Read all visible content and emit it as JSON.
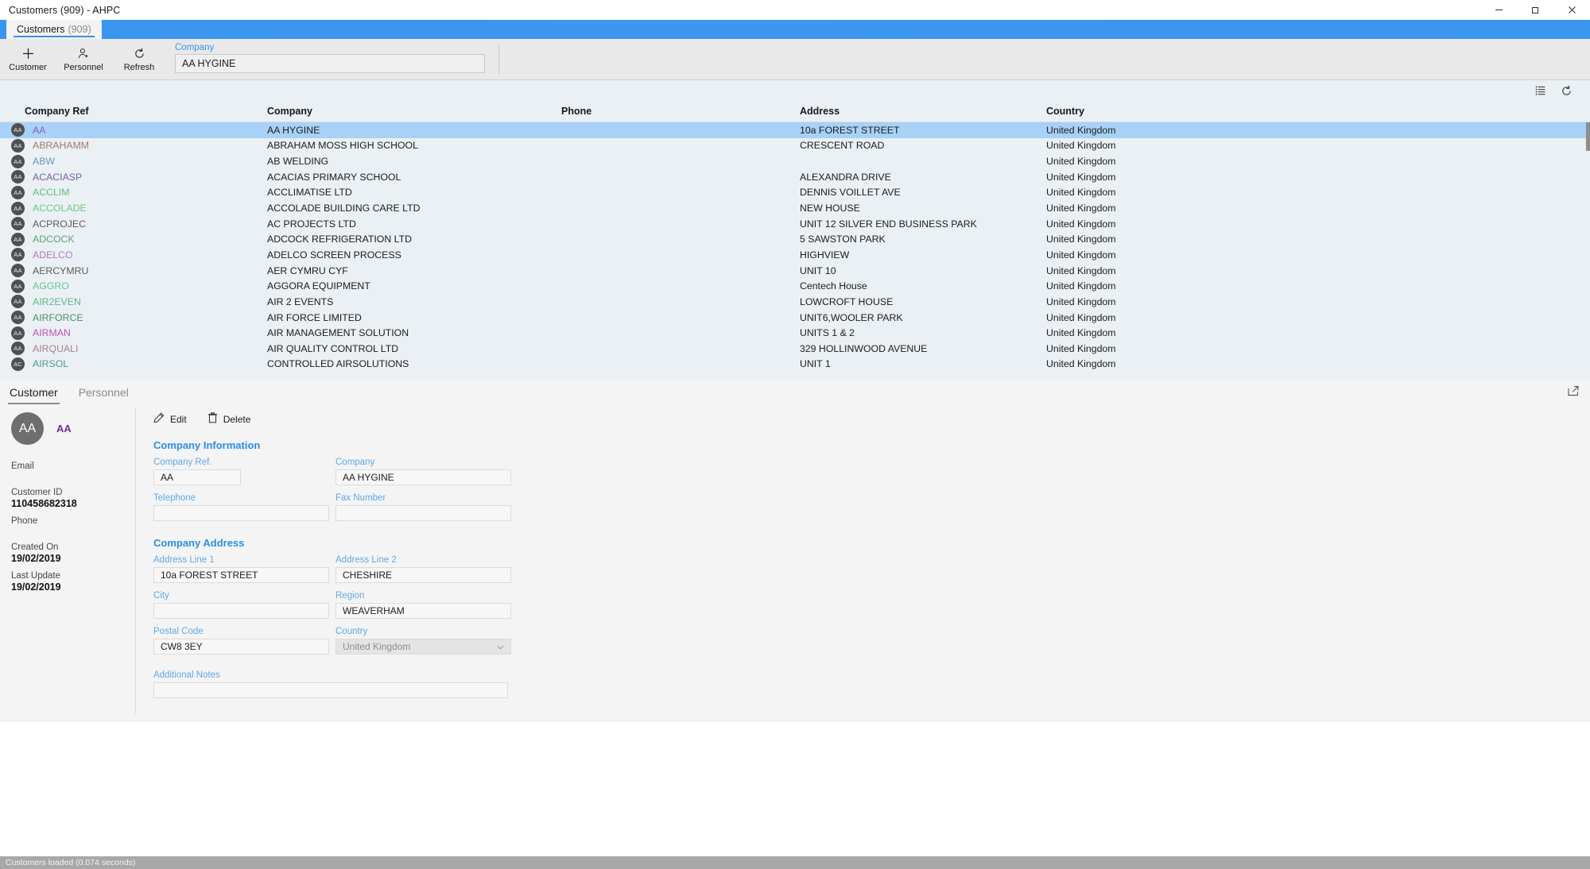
{
  "window": {
    "title": "Customers  (909) - AHPC",
    "minimize_label": "─",
    "maximize_label": "❐",
    "close_label": "✕"
  },
  "tabstrip": {
    "tab_label": "Customers",
    "tab_count": "(909)"
  },
  "toolbar": {
    "customer_label": "Customer",
    "personnel_label": "Personnel",
    "refresh_label": "Refresh",
    "search_label": "Company",
    "search_value": "AA HYGINE",
    "search_placeholder": "Company"
  },
  "grid": {
    "columns": [
      "Company Ref",
      "Company",
      "Phone",
      "Address",
      "Country"
    ],
    "rows": [
      {
        "initials": "AA",
        "ref": "AA",
        "ref_color": "#8a5fc4",
        "company": "AA HYGINE",
        "phone": "",
        "address": "10a FOREST STREET",
        "country": "United Kingdom",
        "selected": true
      },
      {
        "initials": "AA",
        "ref": "ABRAHAMM",
        "ref_color": "#a07b72",
        "company": "ABRAHAM MOSS HIGH SCHOOL",
        "phone": "",
        "address": "CRESCENT ROAD",
        "country": "United Kingdom",
        "selected": false
      },
      {
        "initials": "AA",
        "ref": "ABW",
        "ref_color": "#6c94bd",
        "company": "AB WELDING",
        "phone": "",
        "address": "",
        "country": "United Kingdom",
        "selected": false
      },
      {
        "initials": "AA",
        "ref": "ACACIASP",
        "ref_color": "#7464a8",
        "company": "ACACIAS PRIMARY SCHOOL",
        "phone": "",
        "address": "ALEXANDRA DRIVE",
        "country": "United Kingdom",
        "selected": false
      },
      {
        "initials": "AA",
        "ref": "ACCLIM",
        "ref_color": "#64c06e",
        "company": "ACCLIMATISE LTD",
        "phone": "",
        "address": "DENNIS VOILLET AVE",
        "country": "United Kingdom",
        "selected": false
      },
      {
        "initials": "AA",
        "ref": "ACCOLADE",
        "ref_color": "#72c77a",
        "company": "ACCOLADE BUILDING CARE LTD",
        "phone": "",
        "address": "NEW HOUSE",
        "country": "United Kingdom",
        "selected": false
      },
      {
        "initials": "AA",
        "ref": "ACPROJEC",
        "ref_color": "#5c5c5c",
        "company": "AC PROJECTS LTD",
        "phone": "",
        "address": "UNIT 12 SILVER END BUSINESS PARK",
        "country": "United Kingdom",
        "selected": false
      },
      {
        "initials": "AA",
        "ref": "ADCOCK",
        "ref_color": "#5ba377",
        "company": "ADCOCK REFRIGERATION LTD",
        "phone": "",
        "address": "5 SAWSTON PARK",
        "country": "United Kingdom",
        "selected": false
      },
      {
        "initials": "AA",
        "ref": "ADELCO",
        "ref_color": "#b07ac2",
        "company": "ADELCO SCREEN PROCESS",
        "phone": "",
        "address": "HIGHVIEW",
        "country": "United Kingdom",
        "selected": false
      },
      {
        "initials": "AA",
        "ref": "AERCYMRU",
        "ref_color": "#5c5c5c",
        "company": "AER CYMRU CYF",
        "phone": "",
        "address": "UNIT 10",
        "country": "United Kingdom",
        "selected": false
      },
      {
        "initials": "AA",
        "ref": "AGGRO",
        "ref_color": "#6cc693",
        "company": "AGGORA EQUIPMENT",
        "phone": "",
        "address": "Centech House",
        "country": "United Kingdom",
        "selected": false
      },
      {
        "initials": "AA",
        "ref": "AIR2EVEN",
        "ref_color": "#61b884",
        "company": "AIR 2 EVENTS",
        "phone": "",
        "address": "LOWCROFT HOUSE",
        "country": "United Kingdom",
        "selected": false
      },
      {
        "initials": "AA",
        "ref": "AIRFORCE",
        "ref_color": "#4f8f63",
        "company": "AIR FORCE LIMITED",
        "phone": "",
        "address": "UNIT6,WOOLER PARK",
        "country": "United Kingdom",
        "selected": false
      },
      {
        "initials": "AA",
        "ref": "AIRMAN",
        "ref_color": "#c34fb9",
        "company": "AIR MANAGEMENT SOLUTION",
        "phone": "",
        "address": "UNITS 1 & 2",
        "country": "United Kingdom",
        "selected": false
      },
      {
        "initials": "AA",
        "ref": "AIRQUALI",
        "ref_color": "#a97f8e",
        "company": "AIR QUALITY CONTROL LTD",
        "phone": "",
        "address": "329 HOLLINWOOD AVENUE",
        "country": "United Kingdom",
        "selected": false
      },
      {
        "initials": "AC",
        "ref": "AIRSOL",
        "ref_color": "#4f9a93",
        "company": "CONTROLLED AIRSOLUTIONS",
        "phone": "",
        "address": "UNIT 1",
        "country": "United Kingdom",
        "selected": false
      }
    ]
  },
  "detail": {
    "tabs": [
      {
        "label": "Customer",
        "active": true
      },
      {
        "label": "Personnel",
        "active": false
      }
    ],
    "avatar_initials": "AA",
    "ref_chip": "AA",
    "meta": [
      {
        "label": "Email",
        "value": ""
      },
      {
        "label": "Customer ID",
        "value": "110458682318"
      },
      {
        "label": "Phone",
        "value": ""
      },
      {
        "label": "Created On",
        "value": "19/02/2019"
      },
      {
        "label": "Last Update",
        "value": "19/02/2019"
      }
    ],
    "actions": {
      "edit_label": "Edit",
      "delete_label": "Delete"
    },
    "company_information": {
      "title": "Company Information",
      "company_ref_label": "Company Ref.",
      "company_ref_value": "AA",
      "company_label": "Company",
      "company_value": "AA HYGINE",
      "telephone_label": "Telephone",
      "telephone_value": "",
      "fax_label": "Fax Number",
      "fax_value": ""
    },
    "company_address": {
      "title": "Company Address",
      "address1_label": "Address Line 1",
      "address1_value": "10a FOREST STREET",
      "address2_label": "Address Line 2",
      "address2_value": "CHESHIRE",
      "city_label": "City",
      "city_value": "",
      "region_label": "Region",
      "region_value": "WEAVERHAM",
      "postal_label": "Postal Code",
      "postal_value": "CW8 3EY",
      "country_label": "Country",
      "country_value": "United Kingdom"
    },
    "notes": {
      "label": "Additional Notes",
      "value": ""
    }
  },
  "statusbar": {
    "text": "Customers loaded (0.074 seconds)"
  }
}
